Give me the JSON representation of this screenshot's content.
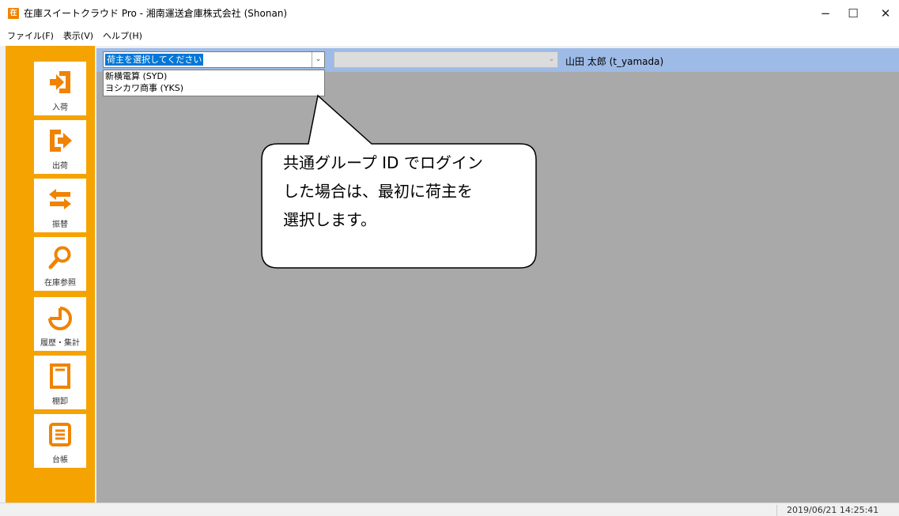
{
  "window": {
    "app_icon_text": "在",
    "title": "在庫スイートクラウド Pro - 湘南運送倉庫株式会社 (Shonan)",
    "minimize_glyph": "−",
    "maximize_glyph": "☐",
    "close_glyph": "✕"
  },
  "menu": {
    "items": [
      {
        "label": "ファイル(F)"
      },
      {
        "label": "表示(V)"
      },
      {
        "label": "ヘルプ(H)"
      }
    ]
  },
  "sidebar": {
    "background": "#f5a300",
    "icon_color": "#f08300",
    "items": [
      {
        "label": "入荷",
        "icon": "inbound-icon"
      },
      {
        "label": "出荷",
        "icon": "outbound-icon"
      },
      {
        "label": "振替",
        "icon": "transfer-icon"
      },
      {
        "label": "在庫参照",
        "icon": "search-icon"
      },
      {
        "label": "履歴・集計",
        "icon": "history-chart-icon"
      },
      {
        "label": "棚卸",
        "icon": "stocktake-icon"
      },
      {
        "label": "台帳",
        "icon": "ledger-icon"
      }
    ]
  },
  "header": {
    "shipper_select_value": "荷主を選択してください",
    "second_select_value": "",
    "user": "山田 太郎 (t_yamada)"
  },
  "dropdown": {
    "options": [
      {
        "label": "新横電算 (SYD)"
      },
      {
        "label": "ヨシカワ商事 (YKS)"
      }
    ]
  },
  "callout": {
    "text_lines": [
      "共通グループ ID でログイン",
      "した場合は、最初に荷主を",
      "選択します。"
    ]
  },
  "status": {
    "datetime": "2019/06/21  14:25:41"
  }
}
